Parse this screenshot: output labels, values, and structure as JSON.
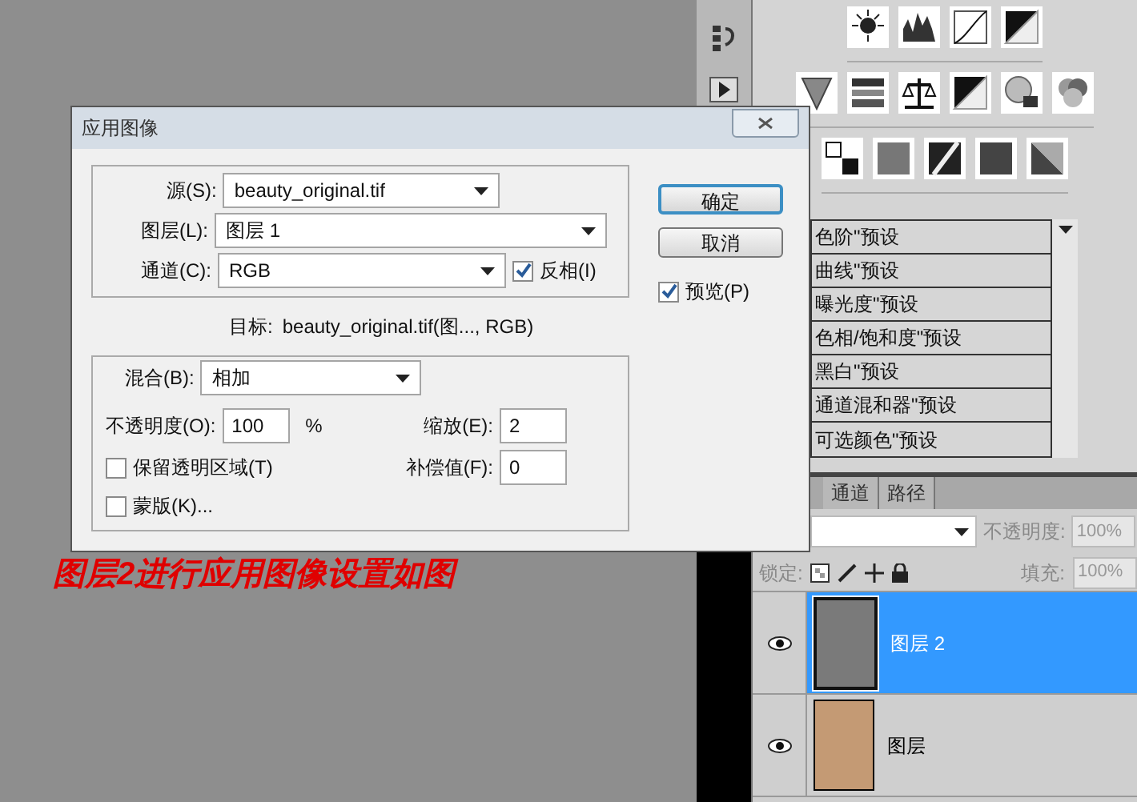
{
  "dialog": {
    "title": "应用图像",
    "source": {
      "label": "源(S):",
      "value": "beauty_original.tif"
    },
    "layer": {
      "label": "图层(L):",
      "value": "图层 1"
    },
    "channel": {
      "label": "通道(C):",
      "value": "RGB"
    },
    "invert": {
      "label": "反相(I)",
      "checked": true
    },
    "target": {
      "label": "目标:",
      "value": "beauty_original.tif(图..., RGB)"
    },
    "blending": {
      "label": "混合(B):",
      "value": "相加"
    },
    "opacity": {
      "label": "不透明度(O):",
      "value": "100",
      "unit": "%"
    },
    "scale": {
      "label": "缩放(E):",
      "value": "2"
    },
    "offset": {
      "label": "补偿值(F):",
      "value": "0"
    },
    "preserve_transparency": {
      "label": "保留透明区域(T)",
      "checked": false
    },
    "mask": {
      "label": "蒙版(K)...",
      "checked": false
    },
    "buttons": [
      {
        "label": "确定",
        "default": true
      },
      {
        "label": "取消",
        "default": false
      }
    ],
    "preview": {
      "label": "预览(P)",
      "checked": true
    }
  },
  "caption": "图层2进行应用图像设置如图",
  "adjustments": {
    "presets": [
      "色阶\"预设",
      "曲线\"预设",
      "曝光度\"预设",
      "色相/饱和度\"预设",
      "黑白\"预设",
      "通道混和器\"预设",
      "可选颜色\"预设"
    ]
  },
  "layers_panel": {
    "tabs": [
      {
        "label": "通道",
        "selected": false
      },
      {
        "label": "路径",
        "selected": false
      }
    ],
    "opacity": {
      "label": "不透明度:",
      "value": "100%",
      "disabled": true
    },
    "lock_label": "锁定:",
    "fill": {
      "label": "填充:",
      "value": "100%",
      "disabled": true
    },
    "layers": [
      {
        "name": "图层 2",
        "selected": true,
        "visible": true,
        "kind": "fill"
      },
      {
        "name": "图层",
        "selected": false,
        "visible": true,
        "kind": "photo"
      }
    ]
  }
}
